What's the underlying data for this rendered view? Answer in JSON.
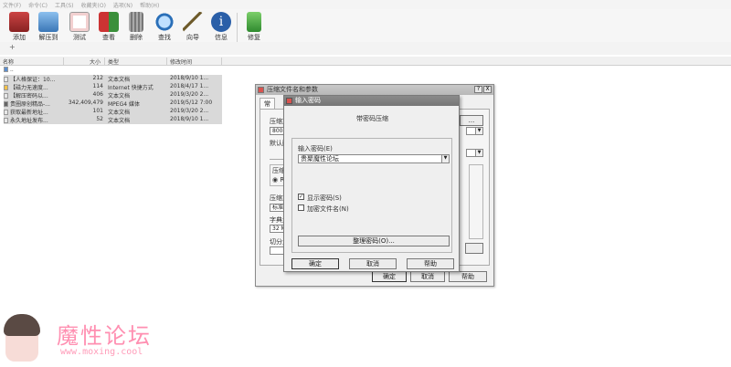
{
  "menu": [
    "文件(F)",
    "命令(C)",
    "工具(S)",
    "收藏夹(O)",
    "选项(N)",
    "帮助(H)"
  ],
  "toolbar": {
    "buttons": [
      {
        "label": "添加",
        "icon": "add-archive-icon",
        "color": "#b23a3a"
      },
      {
        "label": "解压到",
        "icon": "extract-folder-icon",
        "color": "#4a86c6"
      },
      {
        "label": "测试",
        "icon": "test-checklist-icon",
        "color": "#d9534f"
      },
      {
        "label": "查看",
        "icon": "view-book-icon",
        "color": "#3a8f3a"
      },
      {
        "label": "删除",
        "icon": "delete-trash-icon",
        "color": "#777777"
      },
      {
        "label": "查找",
        "icon": "find-magnifier-icon",
        "color": "#2a6fb8"
      },
      {
        "label": "向导",
        "icon": "wizard-wand-icon",
        "color": "#9b7d3a"
      },
      {
        "label": "信息",
        "icon": "info-icon",
        "color": "#2a5fa8"
      },
      {
        "label": "修复",
        "icon": "repair-kit-icon",
        "color": "#3a9a3a"
      }
    ]
  },
  "address": {
    "up_symbol": "+"
  },
  "columns": {
    "name": "名称",
    "size": "大小",
    "type": "类型",
    "modified": "修改时间"
  },
  "files": [
    {
      "name": "..",
      "size": "",
      "type": "",
      "modified": "",
      "selected": false
    },
    {
      "name": "【人格保证：10...",
      "size": "212",
      "type": "文本文档",
      "modified": "2018/9/10 1...",
      "selected": true
    },
    {
      "name": "【磁力无速度...",
      "size": "114",
      "type": "Internet 快捷方式",
      "modified": "2018/4/17 1...",
      "selected": true
    },
    {
      "name": "【解压密码以...",
      "size": "406",
      "type": "文本文档",
      "modified": "2019/3/20 2...",
      "selected": true
    },
    {
      "name": "贵圈原创精品-...",
      "size": "342,409,479",
      "type": "MPEG4 媒体",
      "modified": "2019/5/12 7:00",
      "selected": true
    },
    {
      "name": "获取最新地址...",
      "size": "101",
      "type": "文本文档",
      "modified": "2019/3/20 2...",
      "selected": true
    },
    {
      "name": "永久地址发布...",
      "size": "52",
      "type": "文本文档",
      "modified": "2018/9/10 1...",
      "selected": true
    }
  ],
  "main_dialog": {
    "title": "压缩文件名和参数",
    "help_btn": "?",
    "close_btn": "X",
    "tab_general": "常规",
    "label_archive": "压缩文",
    "archive_value": "8004.",
    "browse_label": "...",
    "label_default": "默认配",
    "label_format": "压缩",
    "format_option": "R",
    "label_method": "压缩方",
    "method_value": "标准",
    "label_dict": "字典大",
    "dict_value": "32 MB",
    "label_split": "切分为",
    "ok": "确定",
    "cancel": "取消",
    "help": "帮助"
  },
  "password_dialog": {
    "title": "输入密码",
    "heading": "带密码压缩",
    "enter_label": "输入密码(E)",
    "password_value": "贵聚魔性论坛",
    "show_password": "显示密码(S)",
    "show_checked": true,
    "encrypt_names": "加密文件名(N)",
    "encrypt_checked": false,
    "organize": "整理密码(O)...",
    "ok": "确定",
    "cancel": "取消",
    "help": "帮助"
  },
  "watermark": {
    "title": "魔性论坛",
    "url": "www.moxing.cool"
  }
}
